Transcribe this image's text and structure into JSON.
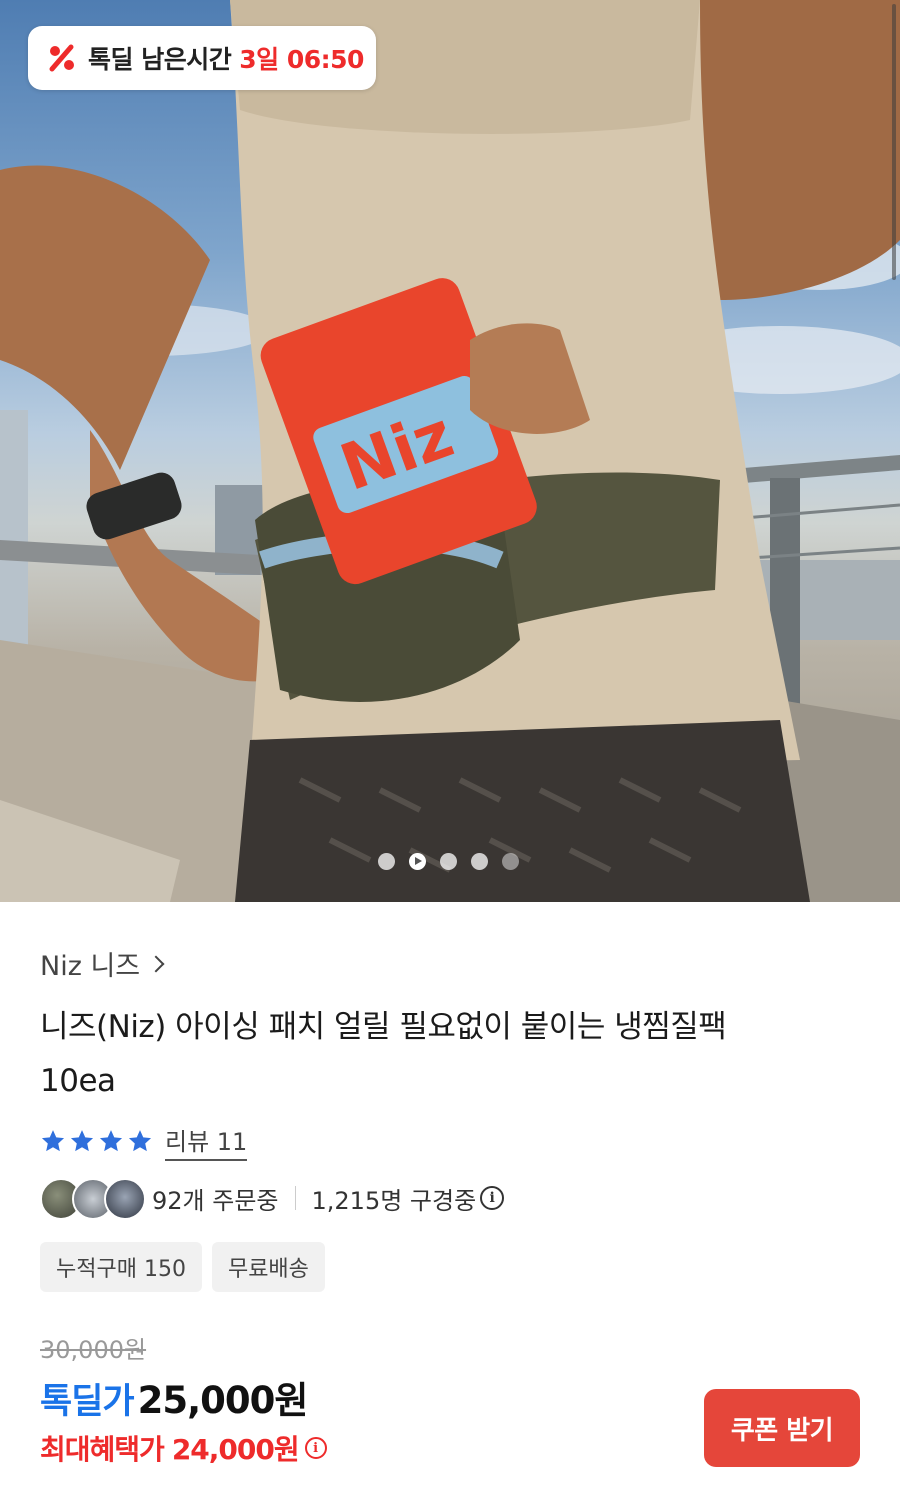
{
  "deal_badge": {
    "label": "톡딜 남은시간",
    "time_remaining": "3일 06:50",
    "icon": "percent-icon"
  },
  "hero": {
    "package_brand_text": "Niz",
    "carousel": {
      "total_slides": 5,
      "active_index": 1,
      "has_video": true
    }
  },
  "product": {
    "brand": "Niz 니즈",
    "title_line1": "니즈(Niz) 아이싱 패치 얼릴 필요없이 붙이는 냉찜질팩",
    "title_line2": "10ea",
    "rating_stars": 4,
    "review_label": "리뷰 11",
    "orders_text": "92개 주문중",
    "viewers_text": "1,215명 구경중",
    "chips": [
      "누적구매 150",
      "무료배송"
    ]
  },
  "price": {
    "original": "30,000원",
    "deal_label": "톡딜가",
    "deal_price": "25,000원",
    "max_benefit_label": "최대혜택가",
    "max_benefit_price": "24,000원"
  },
  "actions": {
    "coupon_button": "쿠폰 받기"
  },
  "colors": {
    "deal_red": "#ee2b2b",
    "deal_blue": "#1a73e8",
    "star_blue": "#2f6fdc",
    "coupon_button": "#e5463a"
  }
}
